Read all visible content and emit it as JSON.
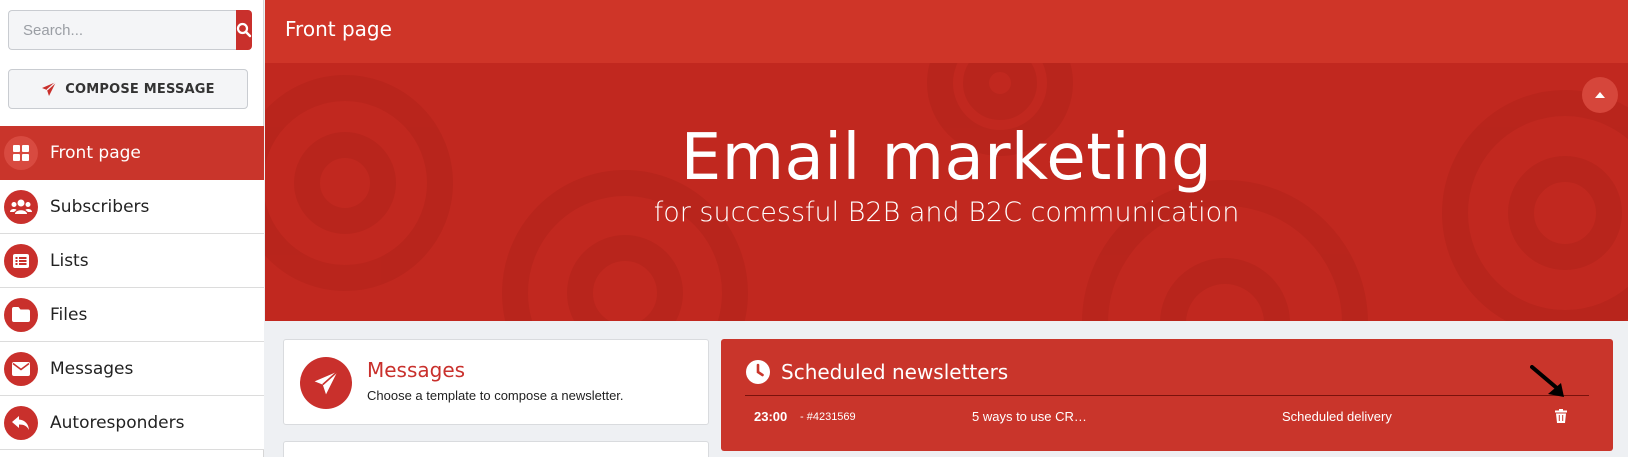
{
  "sidebar": {
    "search": {
      "placeholder": "Search...",
      "value": ""
    },
    "compose_label": "COMPOSE MESSAGE",
    "items": [
      {
        "label": "Front page",
        "icon": "grid-icon",
        "active": true
      },
      {
        "label": "Subscribers",
        "icon": "users-icon",
        "active": false
      },
      {
        "label": "Lists",
        "icon": "list-icon",
        "active": false
      },
      {
        "label": "Files",
        "icon": "folder-icon",
        "active": false
      },
      {
        "label": "Messages",
        "icon": "envelope-icon",
        "active": false
      },
      {
        "label": "Autoresponders",
        "icon": "reply-icon",
        "active": false
      }
    ]
  },
  "header": {
    "title": "Front page"
  },
  "hero": {
    "title": "Email marketing",
    "subtitle": "for successful B2B and B2C communication"
  },
  "messages_card": {
    "title": "Messages",
    "description": "Choose a template to compose a newsletter.",
    "icon": "paper-plane-icon"
  },
  "scheduled": {
    "title": "Scheduled newsletters",
    "icon": "clock-icon",
    "rows": [
      {
        "time": "23:00",
        "id": "- #4231569",
        "subject": "5 ways to use CR…",
        "status": "Scheduled delivery"
      }
    ]
  },
  "colors": {
    "brand": "#c9302c",
    "header": "#cf3528",
    "hero": "#c1281f",
    "active_nav": "#c9352b"
  }
}
